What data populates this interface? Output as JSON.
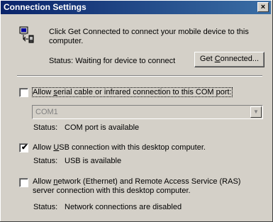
{
  "window": {
    "title": "Connection Settings",
    "close_glyph": "×"
  },
  "header": {
    "icon": "device-connection-icon",
    "text": "Click Get Connected to connect your mobile device to this computer.",
    "status": "Status: Waiting for device to connect",
    "button_prefix": "Get ",
    "button_mnemonic": "C",
    "button_suffix": "onnected..."
  },
  "serial": {
    "checked": false,
    "label_prefix": "Allow ",
    "label_mnemonic": "s",
    "label_suffix": "erial cable or infrared connection to this COM port:",
    "port_value": "COM1",
    "status_label": "Status:",
    "status_value": "COM port is available"
  },
  "usb": {
    "checked": true,
    "check_glyph": "✔",
    "label_prefix": "Allow ",
    "label_mnemonic": "U",
    "label_suffix": "SB connection with this desktop computer.",
    "status_label": "Status:",
    "status_value": "USB is available"
  },
  "network": {
    "checked": false,
    "label_prefix": "Allow ",
    "label_mnemonic": "n",
    "label_suffix": "etwork (Ethernet) and Remote Access Service (RAS) server connection with this desktop computer.",
    "status_label": "Status:",
    "status_value": "Network connections are disabled"
  }
}
